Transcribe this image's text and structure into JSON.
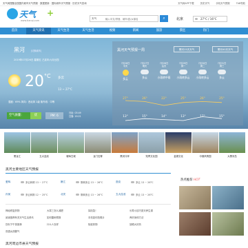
{
  "topbar": {
    "notice": "天气网提醒全国国内城市天气预报 · 数据更新 · 国际城市天气预报 · 历史天气查询",
    "links": [
      "天气网APP下载",
      "历史天气",
      "手机天气预报",
      "TAB导航"
    ]
  },
  "header": {
    "logo": "天气",
    "logo_plus": "+",
    "url": "www.tianqi.com",
    "search_select": "天气",
    "search_placeholder": "输入中文/拼音、城市/县/乡镇名",
    "search_icon": "search-icon",
    "city": "北京",
    "temp": "27°C / 16°C"
  },
  "nav": [
    "首页",
    "天气资讯",
    "天气生活",
    "天气生活",
    "视频",
    "新闻",
    "旅游",
    "景区",
    "热门"
  ],
  "current": {
    "city": "黑河",
    "city_sub": "[切换城市]",
    "date": "2019年07月26日  星期五  己亥年六月廿四",
    "temp": "20",
    "unit": "°C",
    "condition": "多云",
    "range": "13 ~ 27°C",
    "stats": "湿度：69%   风向：西北风 2级   紫外线：中等",
    "aqi_label": "空气质量：",
    "aqi_value": "优",
    "pm": "PM: 6",
    "sunrise": "日出: 03:49",
    "sunset": "日落: 19:21"
  },
  "forecast": {
    "title": "黑河天气预报一周",
    "btn1": "黑河15天天气",
    "btn2": "黑河40天天气",
    "days": [
      {
        "date": "7月26日",
        "week": "今天",
        "cond": "多云",
        "icon": "sun",
        "hi": "27°",
        "lo": "13°"
      },
      {
        "date": "7月27日",
        "week": "明天",
        "cond": "多云",
        "icon": "cloud",
        "hi": "26°",
        "lo": "15°"
      },
      {
        "date": "7月28日",
        "week": "后天",
        "cond": "小雨转中雨",
        "icon": "cloud",
        "hi": "22°",
        "lo": "14°"
      },
      {
        "date": "7月29日",
        "week": "周一",
        "cond": "小雨转多云",
        "icon": "cloud",
        "hi": "25°",
        "lo": "13°"
      },
      {
        "date": "7月30日",
        "week": "周二",
        "cond": "小雨转多云",
        "icon": "cloud",
        "hi": "26°",
        "lo": "17°"
      },
      {
        "date": "7月31日",
        "week": "周三",
        "cond": "多云",
        "icon": "cloud",
        "hi": "25°",
        "lo": "15°"
      }
    ]
  },
  "thumbs": [
    "黑龙江",
    "五大连池",
    "瑷珲古城",
    "龙门石寨",
    "黑河口岸",
    "知青文化园",
    "金源文化",
    "中俄风情园",
    "大黑河岛"
  ],
  "local": {
    "title": "黑河主要地区天气预报",
    "rows": [
      [
        {
          "city": "爱辉",
          "text": "多云转晴  13 ~ 27°C"
        },
        {
          "city": "嫩江",
          "text": "阴转多云  13 ~ 26°C"
        },
        {
          "city": "逊克",
          "text": "多云  13 ~ 26°C"
        }
      ],
      [
        {
          "city": "孙吴",
          "text": "多云转阴  12 ~ 25°C"
        },
        {
          "city": "北安",
          "text": "阴转多云  13 ~ 26°C"
        },
        {
          "city": "五大连池",
          "text": "多云  13 ~ 26°C"
        }
      ]
    ]
  },
  "right": {
    "title": "热点推荐",
    "tag": "HOT"
  },
  "links": [
    [
      "神经修复药物",
      "阅读推荐有关天气生活资讯",
      "饮料下午茶推荐",
      "双重女孩翻气"
    ],
    [
      "大寒三怎么减肥",
      "如何雷雨预报",
      "什么人怎样"
    ],
    [
      "探险急！",
      "手机如何拍照片",
      "除蚊药物"
    ],
    [
      "长寿小技巧夏天养生调",
      "养好身体方法",
      "放眼大好热"
    ]
  ],
  "neighbor_title": "黑河周边市县天气预报"
}
